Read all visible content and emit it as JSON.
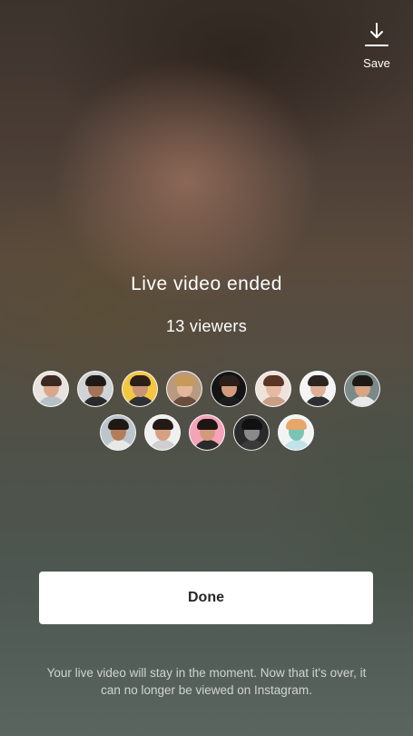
{
  "header": {
    "save_label": "Save",
    "save_icon": "download-icon"
  },
  "live_ended": {
    "title": "Live video ended",
    "viewers_text": "13 viewers"
  },
  "viewers": [
    {
      "name": "viewer-1",
      "bg": "#e8e3de",
      "skin": "#d9a78a",
      "hair": "#3b2a22",
      "shirt": "#b7c0c6"
    },
    {
      "name": "viewer-2",
      "bg": "#cfd3d5",
      "skin": "#a57456",
      "hair": "#1f1a17",
      "shirt": "#2a2a2a"
    },
    {
      "name": "viewer-3",
      "bg": "#f2c744",
      "skin": "#c89475",
      "hair": "#2b1f18",
      "shirt": "#2d3137"
    },
    {
      "name": "viewer-4",
      "bg": "#b89a82",
      "skin": "#e3b89a",
      "hair": "#c79a5a",
      "shirt": "#6b4e3a"
    },
    {
      "name": "viewer-5",
      "bg": "#141414",
      "skin": "#d39b7c",
      "hair": "#2a1f1a",
      "shirt": "#1d1d1d"
    },
    {
      "name": "viewer-6",
      "bg": "#ede3dc",
      "skin": "#e6b9a0",
      "hair": "#5a3424",
      "shirt": "#c99e86"
    },
    {
      "name": "viewer-7",
      "bg": "#f4f4f4",
      "skin": "#deb097",
      "hair": "#2b2420",
      "shirt": "#2d2f33"
    },
    {
      "name": "viewer-8",
      "bg": "#7b8a88",
      "skin": "#d8a484",
      "hair": "#1e1915",
      "shirt": "#e9e9e9"
    },
    {
      "name": "viewer-9",
      "bg": "#bcc5cb",
      "skin": "#b57c5a",
      "hair": "#1f1814",
      "shirt": "#e8e8e8"
    },
    {
      "name": "viewer-10",
      "bg": "#f0f0f0",
      "skin": "#d7a080",
      "hair": "#231a15",
      "shirt": "#cfcfcf"
    },
    {
      "name": "viewer-11",
      "bg": "#f4a3b9",
      "skin": "#d49a7c",
      "hair": "#1d1612",
      "shirt": "#2a2a2a"
    },
    {
      "name": "viewer-12",
      "bg": "#2a2a2a",
      "skin": "#8a8a8a",
      "hair": "#111111",
      "shirt": "#3a3a3a"
    },
    {
      "name": "viewer-13",
      "bg": "#f2f4f4",
      "skin": "#7ac4b5",
      "hair": "#e7a66a",
      "shirt": "#bfe3e8"
    }
  ],
  "done_button": {
    "label": "Done"
  },
  "footer_note": "Your live video will stay in the moment. Now that it's over, it can no longer be viewed on Instagram."
}
